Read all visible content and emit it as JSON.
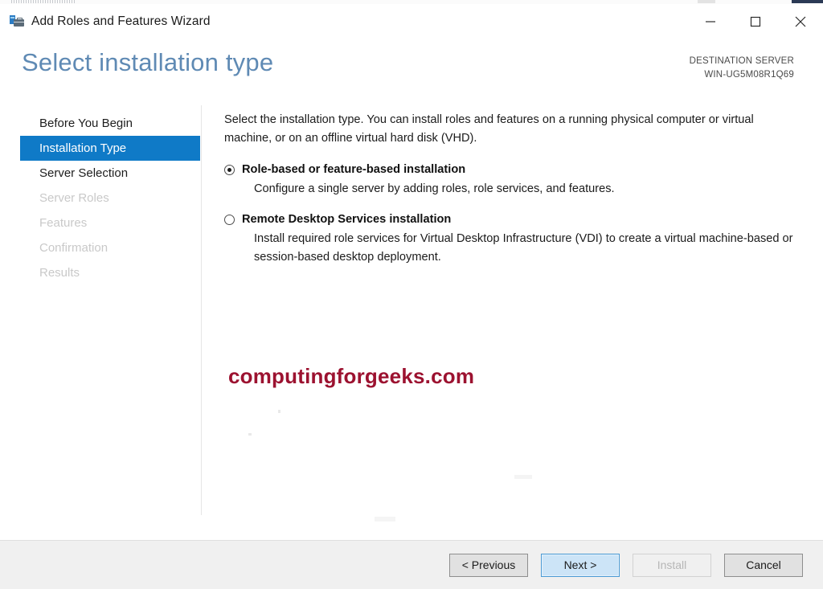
{
  "window": {
    "title": "Add Roles and Features Wizard",
    "icon": "server-roles-icon",
    "controls": {
      "minimize": "minimize-icon",
      "maximize": "maximize-icon",
      "close": "close-icon"
    }
  },
  "header": {
    "page_title": "Select installation type",
    "destination_label": "DESTINATION SERVER",
    "destination_server": "WIN-UG5M08R1Q69",
    "title_color": "#5f8ab4"
  },
  "nav": {
    "items": [
      {
        "label": "Before You Begin",
        "state": "enabled"
      },
      {
        "label": "Installation Type",
        "state": "selected"
      },
      {
        "label": "Server Selection",
        "state": "enabled"
      },
      {
        "label": "Server Roles",
        "state": "disabled"
      },
      {
        "label": "Features",
        "state": "disabled"
      },
      {
        "label": "Confirmation",
        "state": "disabled"
      },
      {
        "label": "Results",
        "state": "disabled"
      }
    ],
    "selected_color": "#0f7ac7",
    "disabled_color": "#c9c9c9"
  },
  "content": {
    "intro": "Select the installation type. You can install roles and features on a running physical computer or virtual machine, or on an offline virtual hard disk (VHD).",
    "options": [
      {
        "title": "Role-based or feature-based installation",
        "description": "Configure a single server by adding roles, role services, and features.",
        "selected": true
      },
      {
        "title": "Remote Desktop Services installation",
        "description": "Install required role services for Virtual Desktop Infrastructure (VDI) to create a virtual machine-based or session-based desktop deployment.",
        "selected": false
      }
    ],
    "watermark": "computingforgeeks.com",
    "watermark_color": "#9c1230"
  },
  "footer": {
    "buttons": [
      {
        "label": "< Previous",
        "style": "normal"
      },
      {
        "label": "Next >",
        "style": "primary"
      },
      {
        "label": "Install",
        "style": "disabled"
      },
      {
        "label": "Cancel",
        "style": "normal"
      }
    ]
  }
}
